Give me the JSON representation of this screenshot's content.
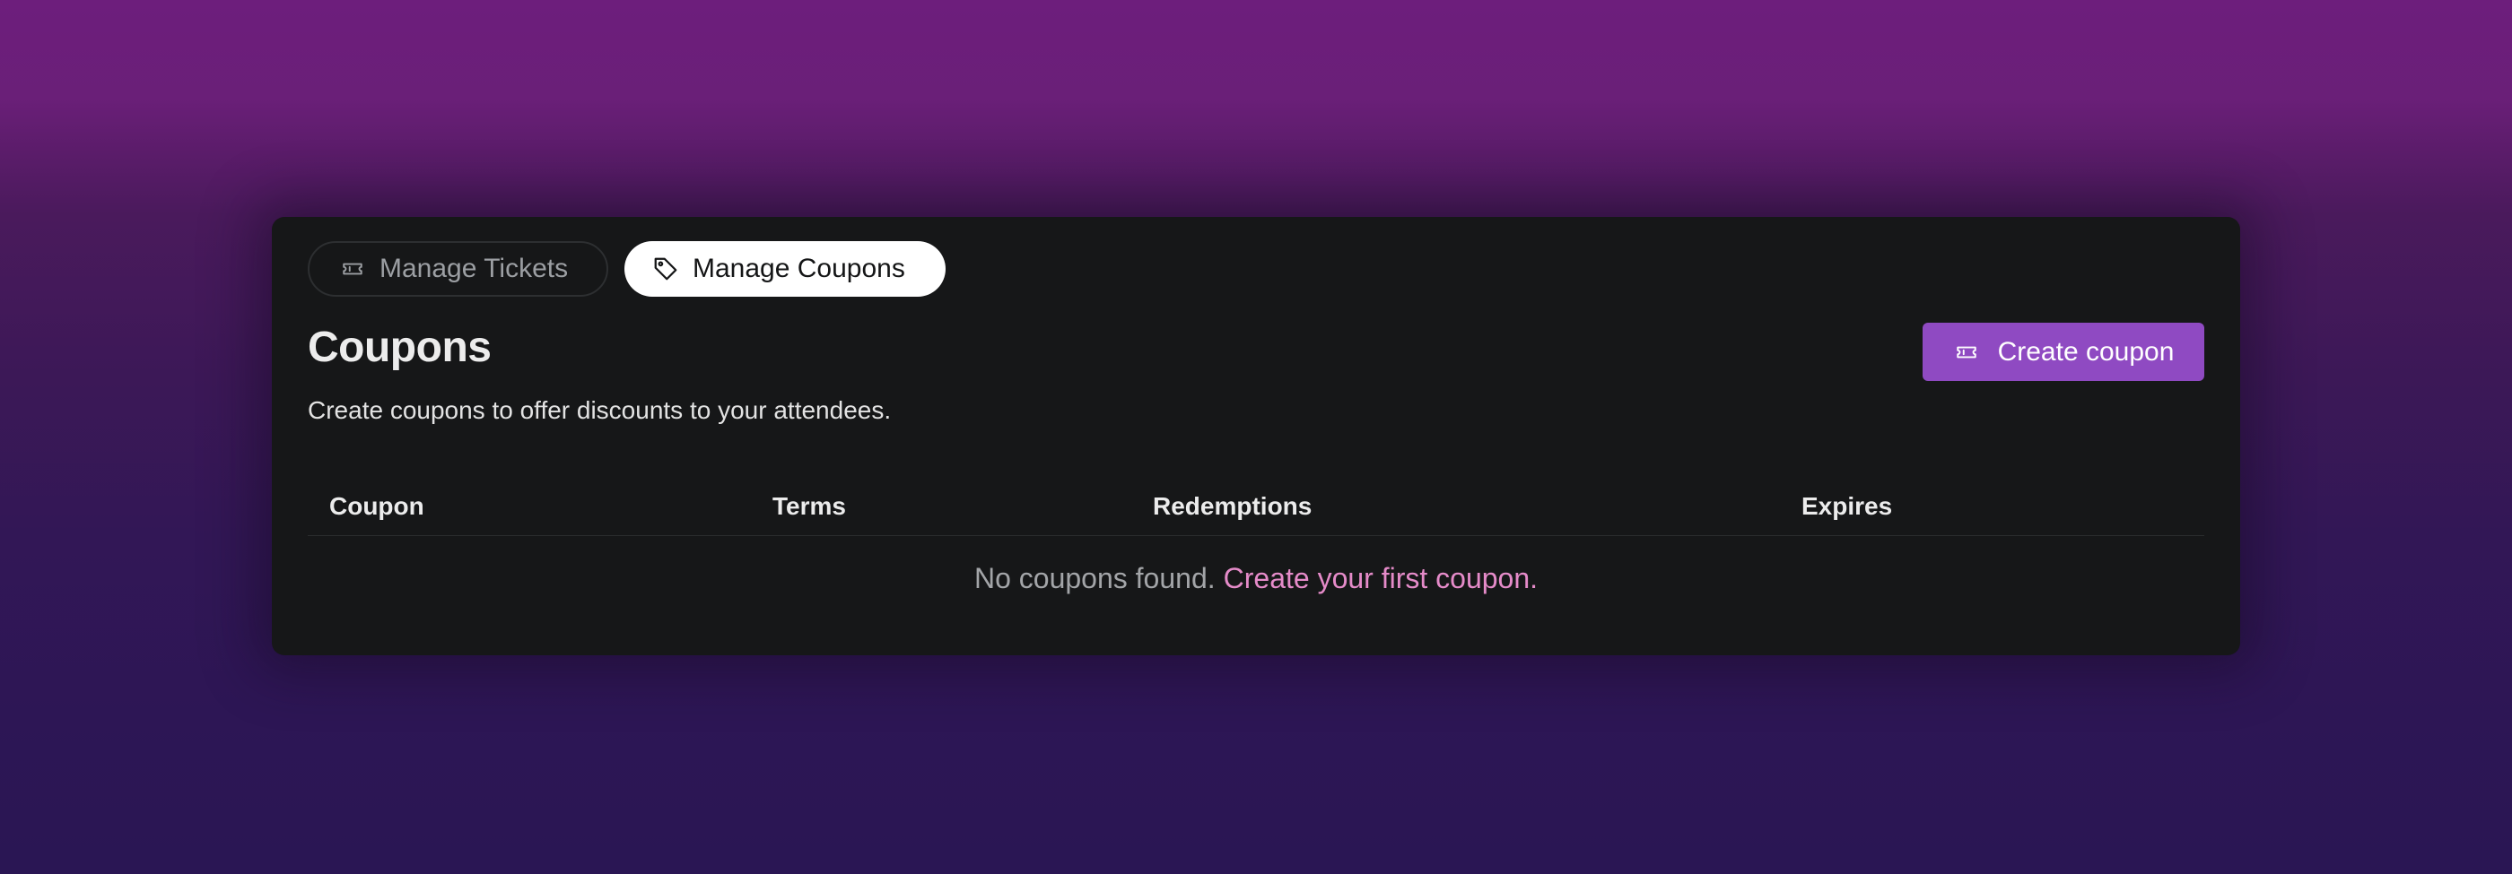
{
  "tabs": [
    {
      "label": "Manage Tickets",
      "icon": "ticket-icon",
      "active": false
    },
    {
      "label": "Manage Coupons",
      "icon": "tag-icon",
      "active": true
    }
  ],
  "page": {
    "title": "Coupons",
    "subtitle": "Create coupons to offer discounts to your attendees."
  },
  "actions": {
    "create_label": "Create coupon",
    "create_icon": "ticket-icon"
  },
  "table": {
    "columns": [
      "Coupon",
      "Terms",
      "Redemptions",
      "Expires"
    ],
    "rows": [],
    "empty_text": "No coupons found.",
    "empty_link": "Create your first coupon."
  },
  "colors": {
    "background_top": "#6d1e7c",
    "background_bottom": "#2a1654",
    "card": "#161718",
    "accent": "#8f4ac2",
    "link": "#e58bc9"
  }
}
